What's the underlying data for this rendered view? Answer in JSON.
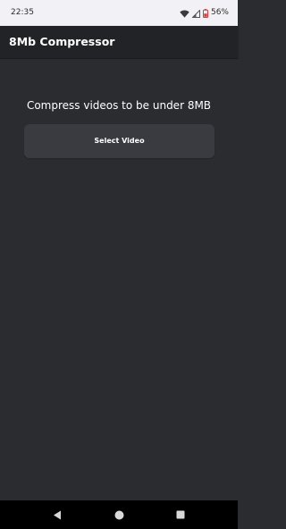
{
  "status_bar": {
    "time": "22:35",
    "battery_percent": "56%",
    "icons": [
      "wifi-icon",
      "cellular-signal-icon",
      "battery-low-icon"
    ]
  },
  "app_bar": {
    "title": "8Mb Compressor"
  },
  "main": {
    "headline": "Compress videos to be under 8MB",
    "select_button_label": "Select Video"
  },
  "nav_bar": {
    "icons": [
      "back-icon",
      "home-icon",
      "recents-icon"
    ]
  },
  "colors": {
    "background": "#2b2c30",
    "app_bar": "#222326",
    "button": "#3a3b40",
    "status_bar": "#f2f2f6",
    "battery_warning": "#e53935"
  }
}
